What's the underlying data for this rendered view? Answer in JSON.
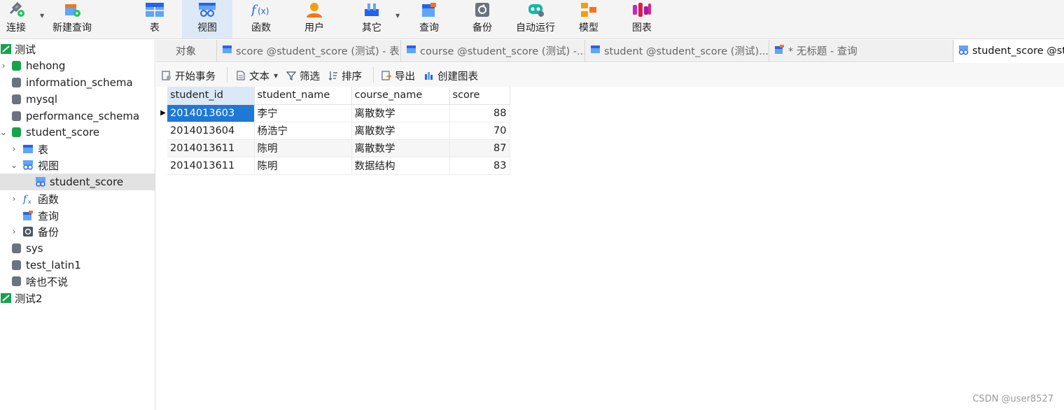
{
  "toolbar": {
    "connect": "连接",
    "new_query": "新建查询",
    "table": "表",
    "view": "视图",
    "function": "函数",
    "user": "用户",
    "other": "其它",
    "query": "查询",
    "backup": "备份",
    "automation": "自动运行",
    "model": "模型",
    "chart": "图表"
  },
  "sidebar": {
    "items": [
      {
        "label": "测试"
      },
      {
        "label": "hehong"
      },
      {
        "label": "information_schema"
      },
      {
        "label": "mysql"
      },
      {
        "label": "performance_schema"
      },
      {
        "label": "student_score"
      },
      {
        "label": "表"
      },
      {
        "label": "视图"
      },
      {
        "label": "student_score"
      },
      {
        "label": "函数"
      },
      {
        "label": "查询"
      },
      {
        "label": "备份"
      },
      {
        "label": "sys"
      },
      {
        "label": "test_latin1"
      },
      {
        "label": "啥也不说"
      },
      {
        "label": "测试2"
      }
    ]
  },
  "tabs": [
    {
      "label": "对象"
    },
    {
      "label": "score @student_score (测试) - 表"
    },
    {
      "label": "course @student_score (测试) -..."
    },
    {
      "label": "student @student_score (测试)..."
    },
    {
      "label": "* 无标题 - 查询"
    },
    {
      "label": "student_score @stu"
    }
  ],
  "subbar": {
    "begin_transaction": "开始事务",
    "text": "文本",
    "filter": "筛选",
    "sort": "排序",
    "export": "导出",
    "create_chart": "创建图表"
  },
  "grid": {
    "columns": [
      "student_id",
      "student_name",
      "course_name",
      "score"
    ],
    "rows": [
      [
        "2014013603",
        "李宁",
        "离散数学",
        "88"
      ],
      [
        "2014013604",
        "杨浩宁",
        "离散数学",
        "70"
      ],
      [
        "2014013611",
        "陈明",
        "离散数学",
        "87"
      ],
      [
        "2014013611",
        "陈明",
        "数据结构",
        "83"
      ]
    ]
  },
  "watermark": "CSDN @user8527",
  "colors": {
    "accent_blue": "#1e78d6",
    "db_green": "#16a34a",
    "db_gray": "#6b7280"
  }
}
